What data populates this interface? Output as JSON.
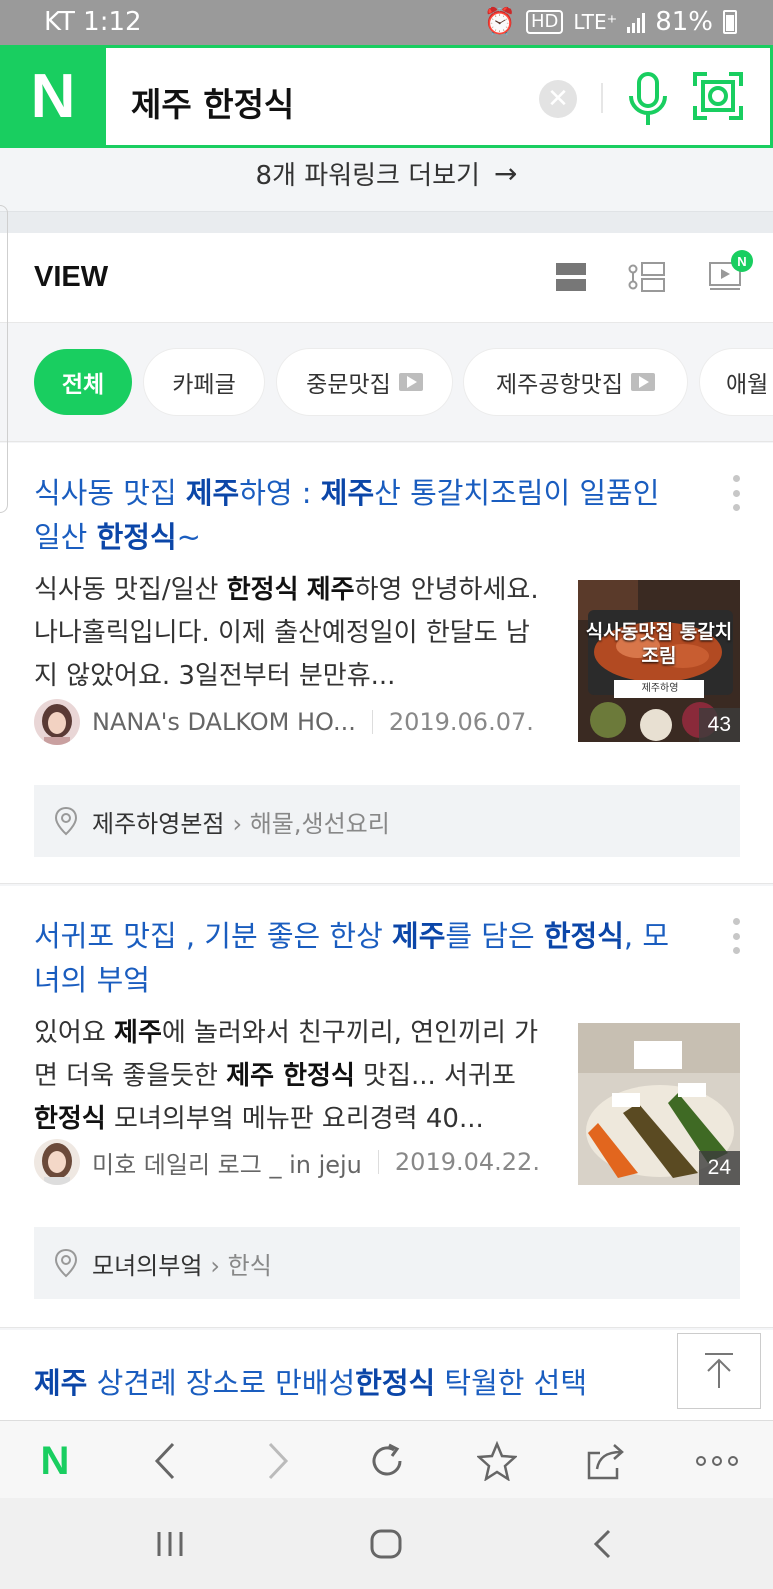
{
  "status_bar": {
    "carrier_time": "KT 1:12",
    "battery": "81%",
    "network": "LTE⁺",
    "hd": "HD"
  },
  "search": {
    "logo": "N",
    "query": "제주 한정식"
  },
  "powerlink": {
    "label": "8개 파워링크 더보기",
    "arrow": "→"
  },
  "view": {
    "title": "VIEW",
    "new_badge": "N"
  },
  "chips": [
    {
      "label": "전체"
    },
    {
      "label": "카페글"
    },
    {
      "label": "중문맛집"
    },
    {
      "label": "제주공항맛집"
    },
    {
      "label": "애월"
    }
  ],
  "results": [
    {
      "title_parts": [
        "식사동 맛집 ",
        "제주",
        "하영 : ",
        "제주",
        "산 통갈치조림이 일품인 일산 ",
        "한정식",
        "~"
      ],
      "desc_parts": [
        "식사동 맛집/일산 ",
        "한정식",
        " ",
        "제주",
        "하영 안녕하세요. 나나홀릭입니다. 이제 출산예정일이 한달도 남지 않았어요. 3일전부터 분만휴..."
      ],
      "author": "NANA's DALKOM HO...",
      "date": "2019.06.07.",
      "thumb_count": "43",
      "thumb_text": "식사동맛집 통갈치조림",
      "thumb_sub": "제주하영",
      "place_name": "제주하영본점",
      "place_category": "› 해물,생선요리"
    },
    {
      "title_parts": [
        "서귀포 맛집 , 기분 좋은 한상 ",
        "제주",
        "를 담은 ",
        "한정식",
        ", 모녀의 부엌"
      ],
      "desc_parts": [
        "있어요 ",
        "제주",
        "에 놀러와서 친구끼리, 연인끼리 가면 더욱 좋을듯한 ",
        "제주 한정식",
        " 맛집... 서귀포 ",
        "한정식",
        " 모녀의부엌 메뉴판 요리경력 40..."
      ],
      "author": "미호 데일리 로그 _ in jeju",
      "date": "2019.04.22.",
      "thumb_count": "24",
      "place_name": "모녀의부엌",
      "place_category": "› 한식"
    }
  ],
  "result3": {
    "title_parts": [
      "제주",
      " 상견례 장소로 만배성",
      "한정식",
      " 탁월한 선택"
    ]
  },
  "colors": {
    "brand_green": "#19ce60",
    "link_blue": "#1a5dbf"
  },
  "icons": {
    "browser_bar": [
      "naver-logo",
      "back-icon",
      "forward-icon",
      "refresh-icon",
      "star-icon",
      "share-icon",
      "more-icon"
    ],
    "nav_bar": [
      "recent-apps-icon",
      "home-icon",
      "back-icon"
    ]
  }
}
